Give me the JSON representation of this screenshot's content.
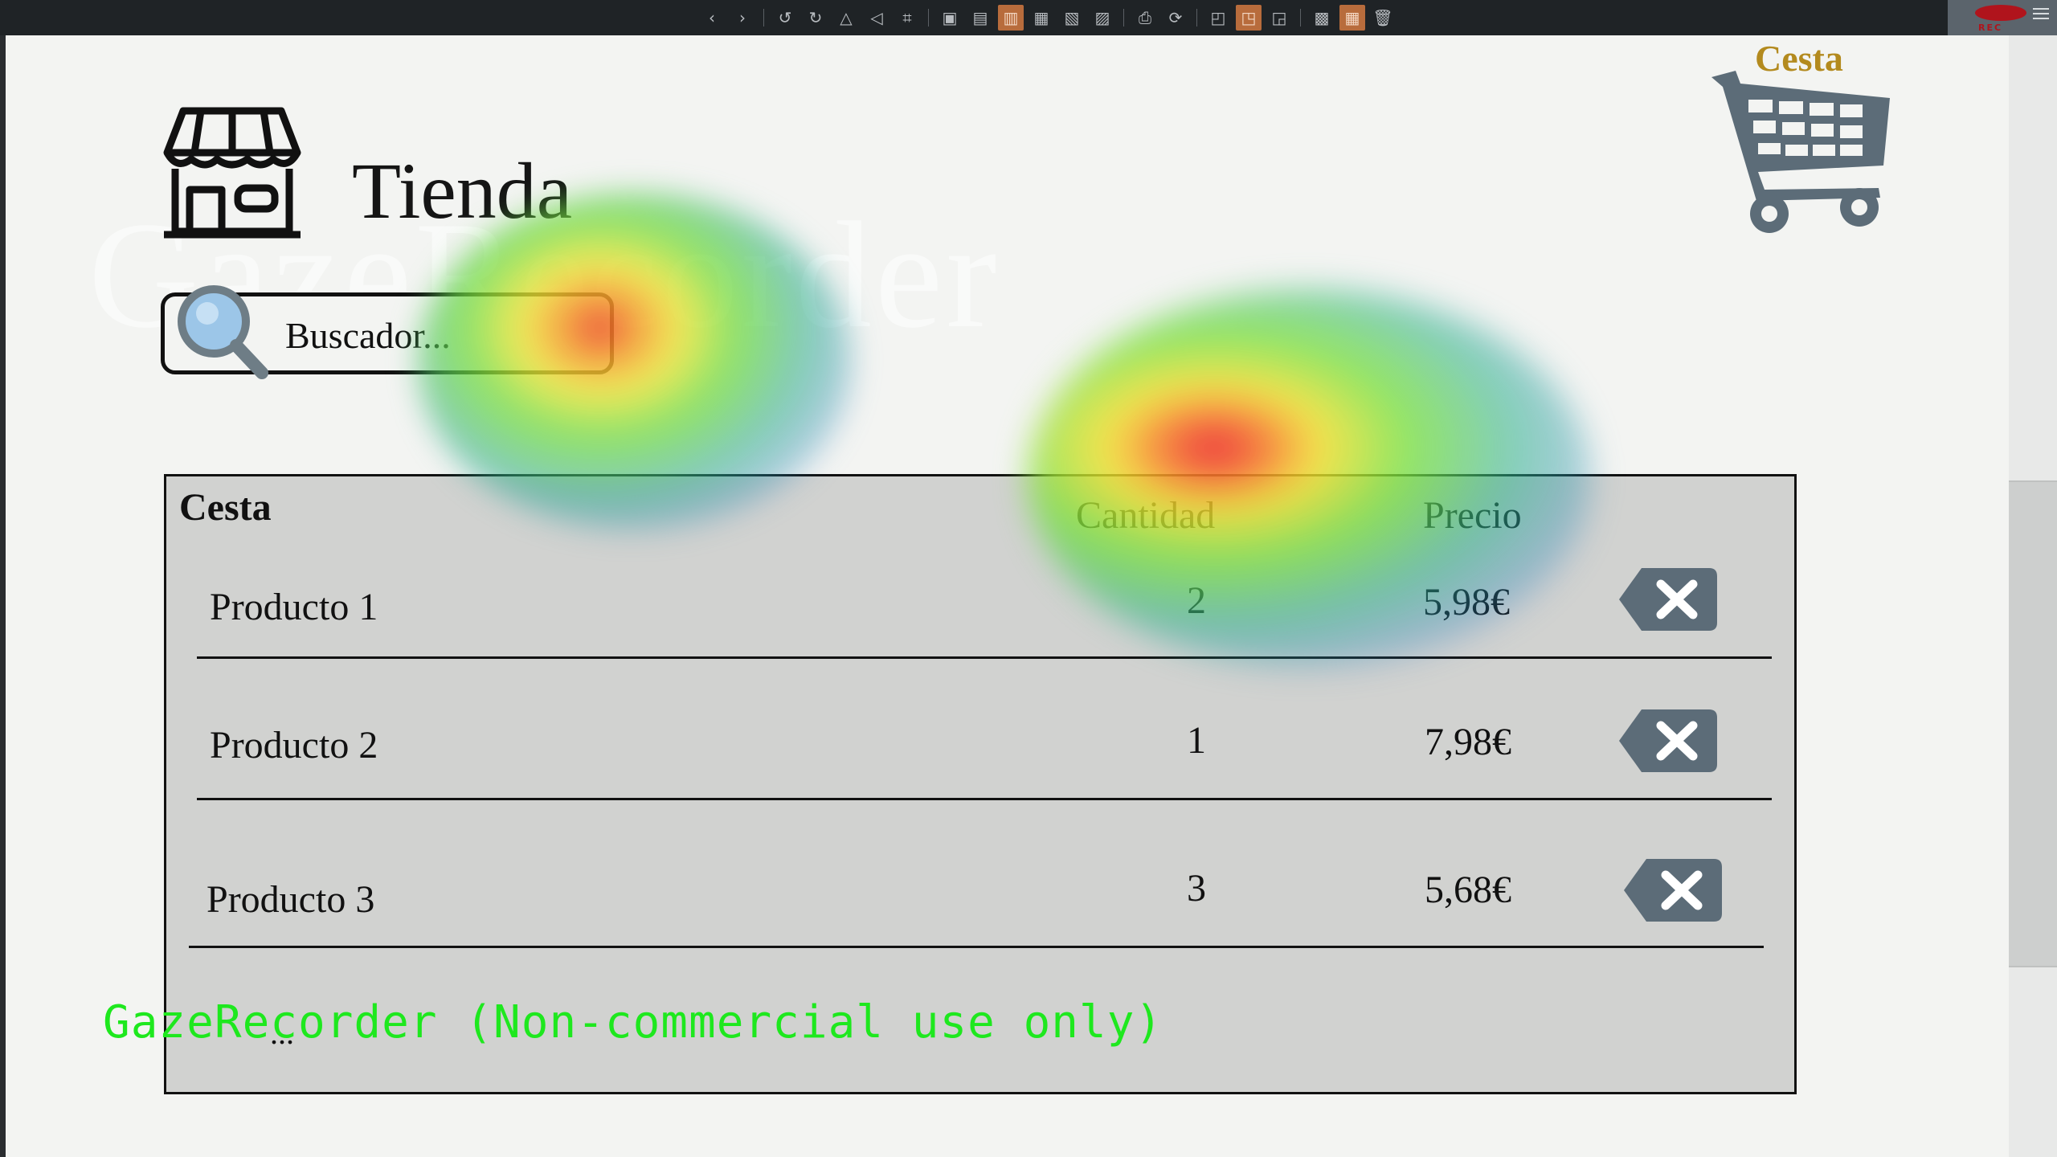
{
  "toolbar": {
    "icons": [
      "back-icon",
      "forward-icon",
      "undo-icon",
      "redo-icon",
      "flip-icon",
      "rotate-icon",
      "crop-icon",
      "frame-icon",
      "lock-icon",
      "image-active-icon",
      "layers-icon",
      "layers2-icon",
      "grid-icon",
      "print-icon",
      "refresh-icon",
      "resize-icon",
      "resize-active-icon",
      "screen-icon",
      "picture-icon",
      "tiles-active-icon",
      "trash-icon"
    ],
    "rec_label": "REC"
  },
  "header": {
    "title": "Tienda",
    "watermark": "GazeRecorder"
  },
  "search": {
    "placeholder": "Buscador..."
  },
  "cart": {
    "label": "Cesta",
    "label_color": "#b38a1e",
    "icon_color": "#5c6c78"
  },
  "basket": {
    "title": "Cesta",
    "headers": {
      "quantity": "Cantidad",
      "price": "Precio"
    },
    "rows": [
      {
        "name": "Producto 1",
        "qty": "2",
        "price": "5,98€"
      },
      {
        "name": "Producto 2",
        "qty": "1",
        "price": "7,98€"
      },
      {
        "name": "Producto 3",
        "qty": "3",
        "price": "5,68€"
      }
    ],
    "more": "..."
  },
  "overlay": {
    "note": "GazeRecorder (Non-commercial use only)",
    "note_color": "#1ee81e"
  }
}
